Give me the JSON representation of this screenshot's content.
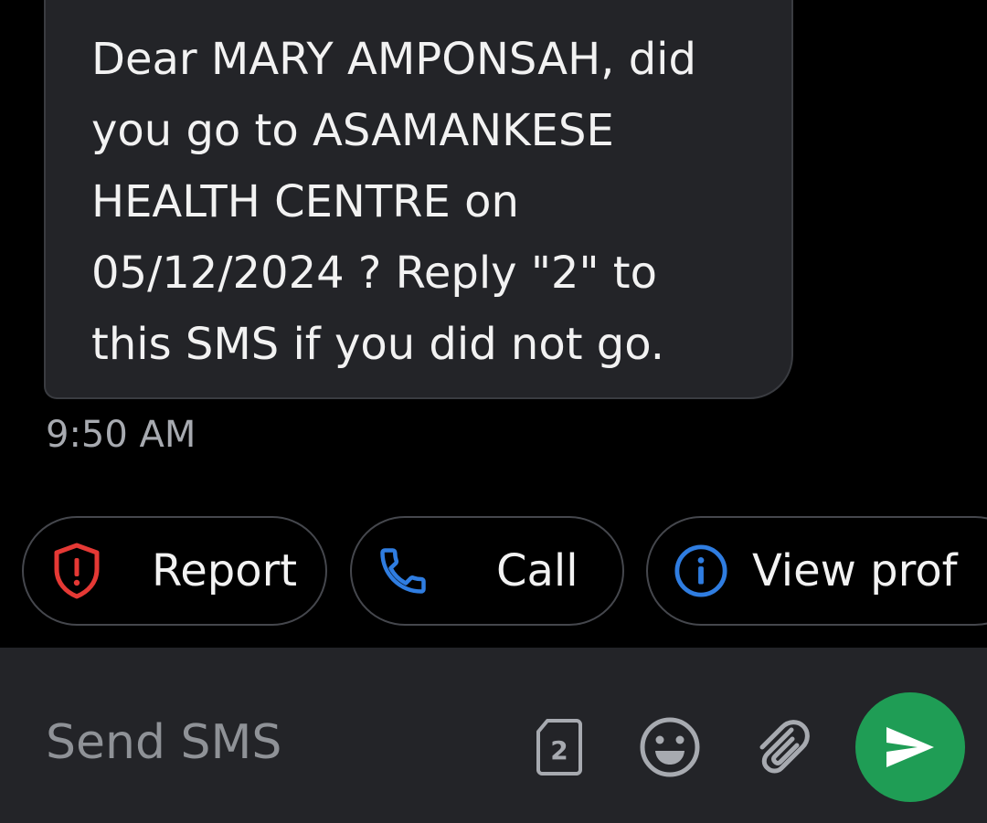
{
  "message": {
    "text": "Dear MARY AMPONSAH, did\nyou go to ASAMANKESE\nHEALTH CENTRE on\n05/12/2024 ? Reply \"2\" to\nthis SMS if you did not go.",
    "time": "9:50 AM"
  },
  "actions": [
    {
      "label": "Report",
      "icon": "shield-alert-icon",
      "color": "#e53935"
    },
    {
      "label": "Call",
      "icon": "phone-icon",
      "color": "#2f7de1"
    },
    {
      "label": "View prof",
      "icon": "info-icon",
      "color": "#2f7de1"
    }
  ],
  "compose": {
    "placeholder": "Send SMS",
    "sim_slot": "2",
    "send_color": "#1f9d55"
  }
}
